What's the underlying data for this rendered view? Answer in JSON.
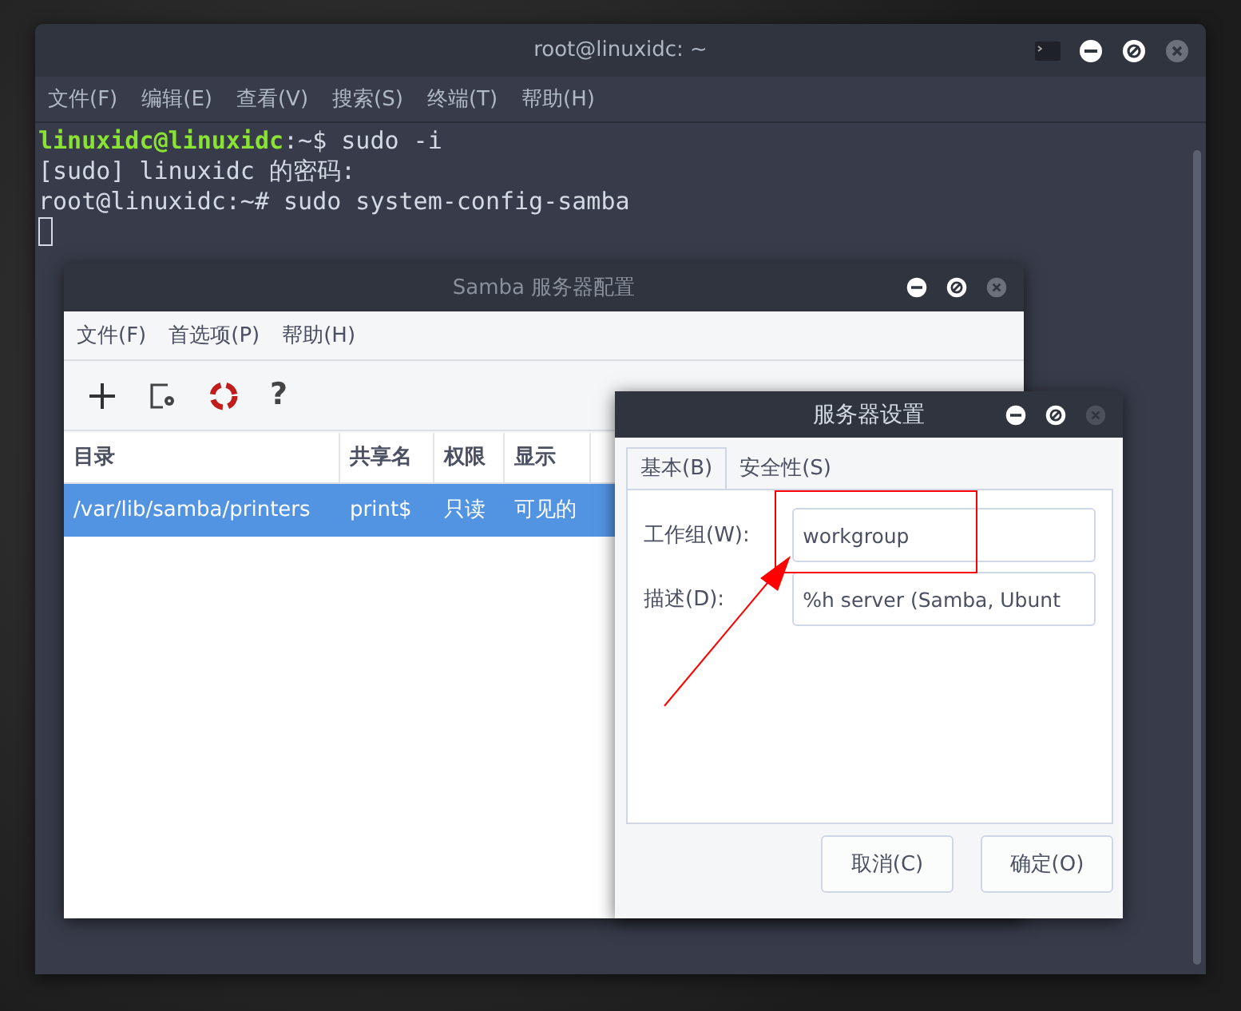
{
  "terminal": {
    "title": "root@linuxidc: ~",
    "menu": [
      "文件(F)",
      "编辑(E)",
      "查看(V)",
      "搜索(S)",
      "终端(T)",
      "帮助(H)"
    ],
    "lines": [
      {
        "prompt": "linuxidc@linuxidc",
        "text": ":~$ sudo -i"
      },
      {
        "text": "[sudo] linuxidc 的密码:"
      },
      {
        "text": "root@linuxidc:~# sudo system-config-samba"
      }
    ]
  },
  "samba_window": {
    "title": "Samba 服务器配置",
    "menu": [
      "文件(F)",
      "首选项(P)",
      "帮助(H)"
    ],
    "toolbar": [
      {
        "kind": "add"
      },
      {
        "kind": "properties"
      },
      {
        "kind": "delete"
      },
      {
        "kind": "help",
        "glyph": "?"
      }
    ],
    "table": {
      "columns": [
        "目录",
        "共享名",
        "权限",
        "显示"
      ],
      "rows": [
        {
          "selected": true,
          "cells": [
            "/var/lib/samba/printers",
            "print$",
            "只读",
            "可见的"
          ]
        }
      ]
    }
  },
  "dialog": {
    "title": "服务器设置",
    "tabs": [
      {
        "label": "基本(B)",
        "selected": true
      },
      {
        "label": "安全性(S)",
        "selected": false
      }
    ],
    "fields": [
      {
        "label": "工作组(W):",
        "value": "workgroup"
      },
      {
        "label": "描述(D):",
        "value": "%h server (Samba, Ubunt"
      }
    ],
    "buttons": [
      "取消(C)",
      "确定(O)"
    ]
  }
}
